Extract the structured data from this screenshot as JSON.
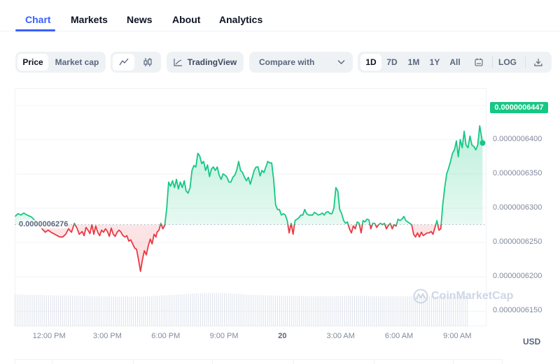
{
  "tabs": [
    {
      "label": "Chart",
      "active": true
    },
    {
      "label": "Markets",
      "active": false
    },
    {
      "label": "News",
      "active": false
    },
    {
      "label": "About",
      "active": false
    },
    {
      "label": "Analytics",
      "active": false
    }
  ],
  "toolbar": {
    "data_toggle": [
      "Price",
      "Market cap"
    ],
    "data_toggle_selected": "Price",
    "chart_type_icons": [
      "line-chart-icon",
      "candlestick-icon"
    ],
    "chart_type_selected": "line",
    "tradingview_label": "TradingView",
    "tradingview_icon": "trend-chart-icon",
    "compare_label": "Compare with",
    "compare_icon": "chevron-down-icon",
    "ranges": [
      "1D",
      "7D",
      "1M",
      "1Y",
      "All"
    ],
    "range_selected": "1D",
    "calendar_icon": "calendar-icon",
    "log_label": "LOG",
    "download_icon": "download-icon"
  },
  "colors": {
    "up": "#16c784",
    "down": "#ea3943",
    "accent": "#3861fb",
    "volume": "#cfd6e4"
  },
  "watermark": "CoinMarketCap",
  "currency_label": "USD",
  "chart_data": {
    "type": "line",
    "title": "",
    "xlabel": "",
    "ylabel": "USD",
    "current_price_label": "0.0000006447",
    "baseline_label": "0.0000006276",
    "baseline": 6.276e-07,
    "ylim": [
      6.128e-07,
      6.475e-07
    ],
    "y_ticks": [
      {
        "value": 6.4e-07,
        "label": "0.0000006400"
      },
      {
        "value": 6.35e-07,
        "label": "0.0000006350"
      },
      {
        "value": 6.3e-07,
        "label": "0.0000006300"
      },
      {
        "value": 6.25e-07,
        "label": "0.0000006250"
      },
      {
        "value": 6.2e-07,
        "label": "0.0000006200"
      },
      {
        "value": 6.15e-07,
        "label": "0.0000006150"
      }
    ],
    "x_unit": "hours since 12:00 PM",
    "xlim": [
      -1.77,
      22.5
    ],
    "x_ticks": [
      {
        "value": 0,
        "label": "12:00 PM",
        "bold": false
      },
      {
        "value": 3,
        "label": "3:00 PM",
        "bold": false
      },
      {
        "value": 6,
        "label": "6:00 PM",
        "bold": false
      },
      {
        "value": 9,
        "label": "9:00 PM",
        "bold": false
      },
      {
        "value": 12,
        "label": "20",
        "bold": true
      },
      {
        "value": 15,
        "label": "3:00 AM",
        "bold": false
      },
      {
        "value": 18,
        "label": "6:00 AM",
        "bold": false
      },
      {
        "value": 21,
        "label": "9:00 AM",
        "bold": false
      }
    ],
    "grid": true,
    "legend": "none",
    "series": [
      {
        "name": "Price",
        "x": [
          -1.75,
          -1.6,
          -1.45,
          -1.3,
          -1.2,
          -1.05,
          -0.9,
          -0.2,
          -0.05,
          0.1,
          0.55,
          0.7,
          0.85,
          1.0,
          1.15,
          1.3,
          1.45,
          1.55,
          1.7,
          1.8,
          1.9,
          2.0,
          2.1,
          2.2,
          2.3,
          2.4,
          2.5,
          2.6,
          2.7,
          2.8,
          2.9,
          3.0,
          3.1,
          3.2,
          3.3,
          3.4,
          3.5,
          3.6,
          3.7,
          3.8,
          3.9,
          4.0,
          4.1,
          4.2,
          4.3,
          4.4,
          4.5,
          4.6,
          4.7,
          4.8,
          4.9,
          5.0,
          5.1,
          5.2,
          5.3,
          5.4,
          5.5,
          5.55,
          5.65,
          5.75,
          5.85,
          5.95,
          6.05,
          6.15,
          6.25,
          6.35,
          6.45,
          6.55,
          6.65,
          6.75,
          6.85,
          6.95,
          7.05,
          7.15,
          7.25,
          7.35,
          7.45,
          7.55,
          7.65,
          7.75,
          7.85,
          7.95,
          8.05,
          8.15,
          8.25,
          8.35,
          8.45,
          8.55,
          8.65,
          8.75,
          8.85,
          8.95,
          9.05,
          9.15,
          9.25,
          9.35,
          9.45,
          9.55,
          9.65,
          9.75,
          9.85,
          9.95,
          10.05,
          10.15,
          10.25,
          10.35,
          10.45,
          10.55,
          10.65,
          10.75,
          10.85,
          10.95,
          11.05,
          11.15,
          11.25,
          11.35,
          11.45,
          11.55,
          11.65,
          11.75,
          11.85,
          11.95,
          12.05,
          12.15,
          12.25,
          12.35,
          12.45,
          12.55,
          12.65,
          12.75,
          12.85,
          12.95,
          13.05,
          13.15,
          13.25,
          13.35,
          13.45,
          13.55,
          13.65,
          13.75,
          13.85,
          13.95,
          14.05,
          14.15,
          14.25,
          14.35,
          14.45,
          14.55,
          14.65,
          14.75,
          14.85,
          14.95,
          15.05,
          15.15,
          15.25,
          15.35,
          15.45,
          15.55,
          15.65,
          15.75,
          15.85,
          15.95,
          16.05,
          16.15,
          16.25,
          16.35,
          16.45,
          16.55,
          16.65,
          16.75,
          16.85,
          16.95,
          17.05,
          17.15,
          17.25,
          17.35,
          17.45,
          17.55,
          17.65,
          17.75,
          17.85,
          17.95,
          18.05,
          18.15,
          18.25,
          18.35,
          18.45,
          18.55,
          18.65,
          18.75,
          18.85,
          18.95,
          19.05,
          19.15,
          19.25,
          19.35,
          19.45,
          19.55,
          19.65,
          19.75,
          19.85,
          19.95,
          20.05,
          20.15,
          20.25,
          20.35,
          20.45,
          20.55,
          20.65,
          20.75,
          20.85,
          20.95,
          21.05,
          21.15,
          21.25,
          21.35,
          21.45,
          21.55,
          21.65,
          21.75,
          21.85,
          21.95,
          22.05,
          22.15,
          22.3
        ],
        "values": [
          6.288e-07,
          6.292e-07,
          6.29e-07,
          6.293e-07,
          6.291e-07,
          6.289e-07,
          6.287e-07,
          6.265e-07,
          6.268e-07,
          6.265e-07,
          6.258e-07,
          6.258e-07,
          6.262e-07,
          6.27e-07,
          6.265e-07,
          6.278e-07,
          6.27e-07,
          6.262e-07,
          6.266e-07,
          6.26e-07,
          6.272e-07,
          6.268e-07,
          6.263e-07,
          6.276e-07,
          6.262e-07,
          6.274e-07,
          6.265e-07,
          6.26e-07,
          6.268e-07,
          6.265e-07,
          6.27e-07,
          6.266e-07,
          6.259e-07,
          6.271e-07,
          6.262e-07,
          6.259e-07,
          6.265e-07,
          6.268e-07,
          6.265e-07,
          6.26e-07,
          6.258e-07,
          6.26e-07,
          6.252e-07,
          6.254e-07,
          6.248e-07,
          6.242e-07,
          6.24e-07,
          6.225e-07,
          6.208e-07,
          6.225e-07,
          6.238e-07,
          6.232e-07,
          6.245e-07,
          6.255e-07,
          6.248e-07,
          6.262e-07,
          6.258e-07,
          6.265e-07,
          6.268e-07,
          6.278e-07,
          6.27e-07,
          6.275e-07,
          6.3e-07,
          6.338e-07,
          6.332e-07,
          6.34e-07,
          6.33e-07,
          6.342e-07,
          6.328e-07,
          6.338e-07,
          6.33e-07,
          6.34e-07,
          6.325e-07,
          6.322e-07,
          6.33e-07,
          6.355e-07,
          6.362e-07,
          6.36e-07,
          6.38e-07,
          6.376e-07,
          6.365e-07,
          6.368e-07,
          6.355e-07,
          6.363e-07,
          6.346e-07,
          6.357e-07,
          6.36e-07,
          6.355e-07,
          6.36e-07,
          6.348e-07,
          6.342e-07,
          6.35e-07,
          6.348e-07,
          6.345e-07,
          6.338e-07,
          6.338e-07,
          6.345e-07,
          6.348e-07,
          6.355e-07,
          6.368e-07,
          6.355e-07,
          6.352e-07,
          6.345e-07,
          6.34e-07,
          6.345e-07,
          6.335e-07,
          6.345e-07,
          6.355e-07,
          6.36e-07,
          6.36e-07,
          6.347e-07,
          6.355e-07,
          6.352e-07,
          6.36e-07,
          6.368e-07,
          6.366e-07,
          6.366e-07,
          6.342e-07,
          6.305e-07,
          6.298e-07,
          6.298e-07,
          6.29e-07,
          6.292e-07,
          6.29e-07,
          6.282e-07,
          6.264e-07,
          6.278e-07,
          6.262e-07,
          6.282e-07,
          6.284e-07,
          6.286e-07,
          6.29e-07,
          6.29e-07,
          6.298e-07,
          6.292e-07,
          6.29e-07,
          6.29e-07,
          6.29e-07,
          6.294e-07,
          6.292e-07,
          6.29e-07,
          6.291e-07,
          6.293e-07,
          6.29e-07,
          6.294e-07,
          6.295e-07,
          6.292e-07,
          6.292e-07,
          6.3e-07,
          6.33e-07,
          6.325e-07,
          6.298e-07,
          6.292e-07,
          6.282e-07,
          6.278e-07,
          6.28e-07,
          6.27e-07,
          6.264e-07,
          6.274e-07,
          6.27e-07,
          6.28e-07,
          6.278e-07,
          6.264e-07,
          6.282e-07,
          6.28e-07,
          6.284e-07,
          6.283e-07,
          6.27e-07,
          6.278e-07,
          6.278e-07,
          6.272e-07,
          6.276e-07,
          6.278e-07,
          6.276e-07,
          6.278e-07,
          6.27e-07,
          6.275e-07,
          6.278e-07,
          6.27e-07,
          6.276e-07,
          6.274e-07,
          6.284e-07,
          6.282e-07,
          6.284e-07,
          6.288e-07,
          6.282e-07,
          6.28e-07,
          6.278e-07,
          6.276e-07,
          6.262e-07,
          6.258e-07,
          6.264e-07,
          6.258e-07,
          6.265e-07,
          6.26e-07,
          6.262e-07,
          6.264e-07,
          6.264e-07,
          6.266e-07,
          6.262e-07,
          6.272e-07,
          6.282e-07,
          6.268e-07,
          6.27e-07,
          6.305e-07,
          6.33e-07,
          6.35e-07,
          6.358e-07,
          6.368e-07,
          6.38e-07,
          6.385e-07,
          6.398e-07,
          6.375e-07,
          6.4e-07,
          6.388e-07,
          6.412e-07,
          6.392e-07,
          6.388e-07,
          6.405e-07,
          6.392e-07,
          6.39e-07,
          6.385e-07,
          6.392e-07,
          6.42e-07,
          6.395e-07,
          6.385e-07,
          6.39e-07,
          6.44e-07,
          6.447e-07
        ]
      },
      {
        "name": "Volume",
        "type": "bar",
        "relative_values_note": "volume bars shown unlabeled; relative heights 0-1",
        "x_start": -1.75,
        "x_end": 21.5,
        "values": [
          0.92,
          0.9,
          0.9,
          0.89,
          0.88,
          0.88,
          0.87,
          0.86,
          0.86,
          0.85,
          0.85,
          0.85,
          0.86,
          0.88,
          0.9,
          0.92,
          0.94,
          0.95,
          0.95,
          0.94,
          0.92,
          0.9,
          0.89,
          0.88,
          0.87,
          0.87,
          0.86,
          0.86,
          0.86,
          0.87,
          0.87,
          0.87,
          0.86,
          0.86,
          0.86,
          0.86,
          0.86,
          0.86,
          0.86,
          0.85,
          0.86
        ]
      }
    ]
  }
}
